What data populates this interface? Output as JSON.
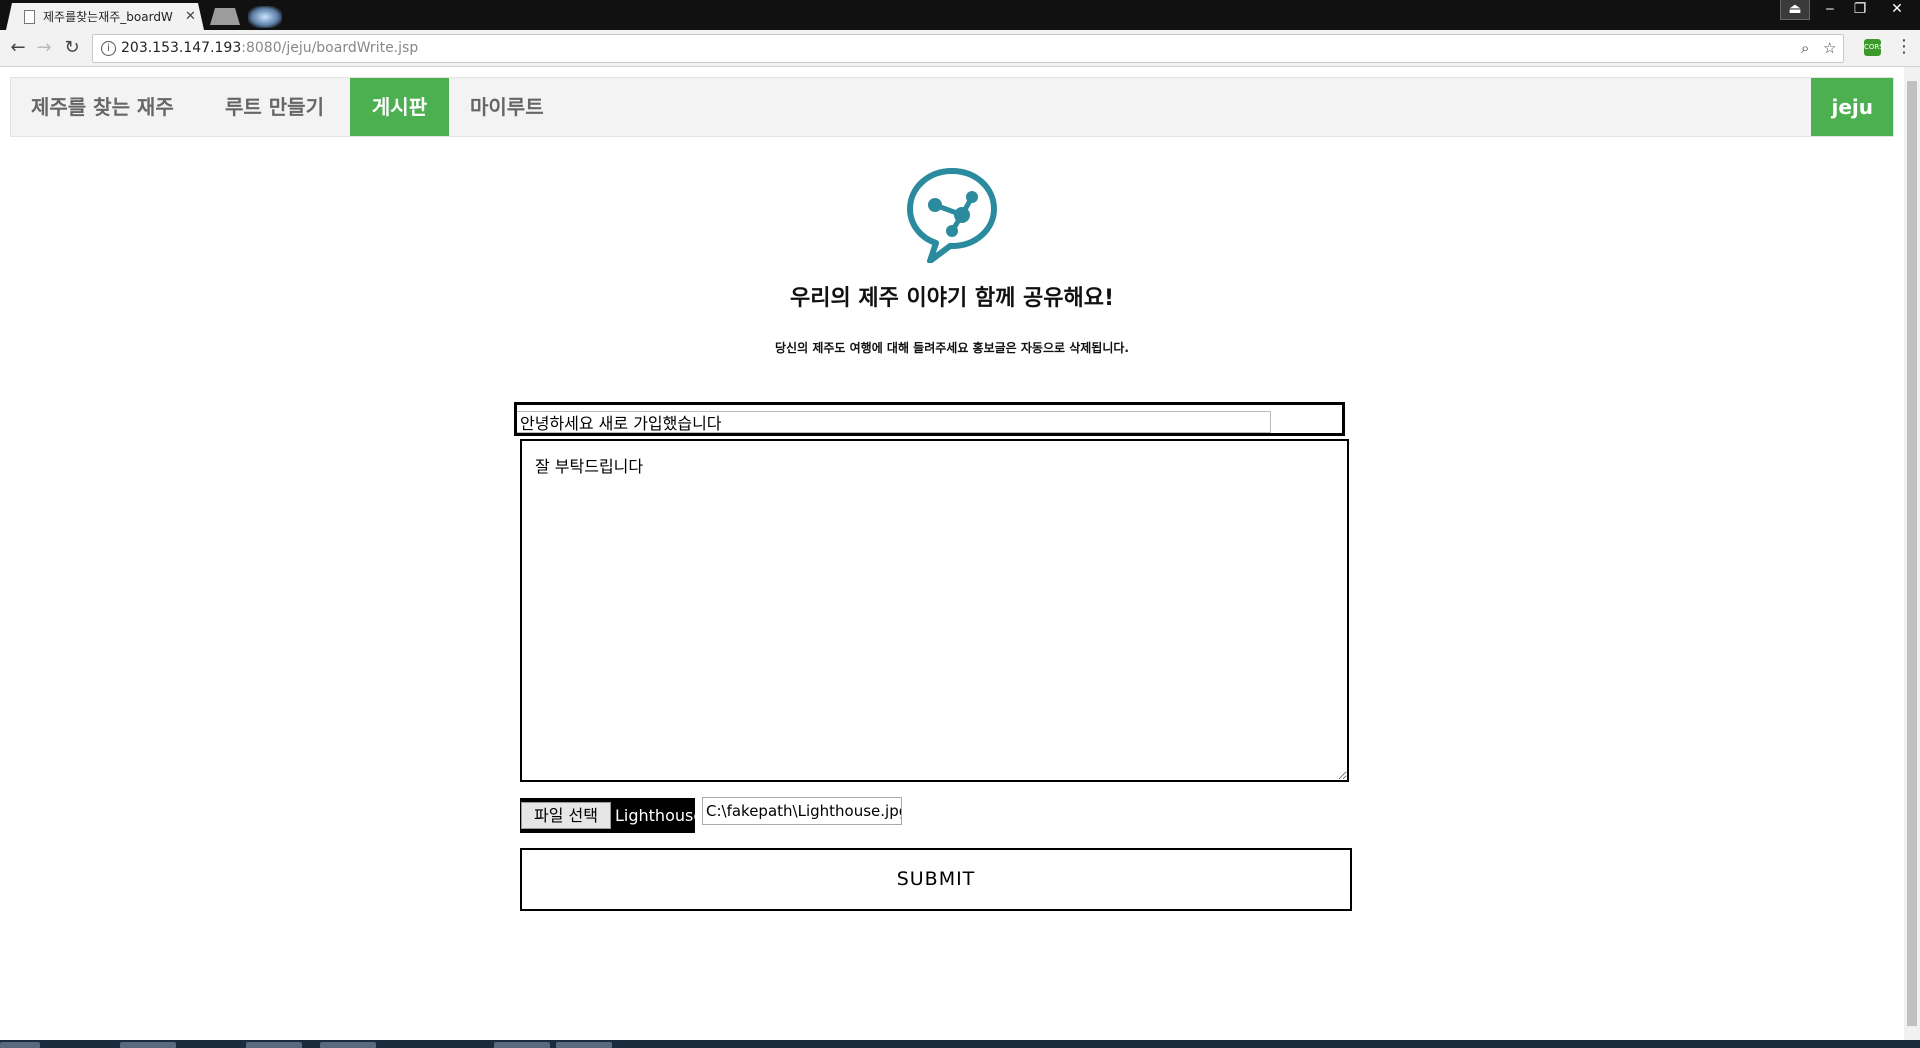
{
  "browser": {
    "tab_title": "제주를찾는재주_boardW",
    "url_host": "203.153.147.193",
    "url_path": ":8080/jeju/boardWrite.jsp",
    "ext_label": "CORS"
  },
  "nav": {
    "items": [
      "제주를 찾는 재주",
      "루트 만들기",
      "게시판",
      "마이루트"
    ],
    "active_index": 2,
    "user": "jeju"
  },
  "page": {
    "logo_icon": "share-chat-icon",
    "headline": "우리의 제주 이야기 함께 공유해요!",
    "subline": "당신의 제주도 여행에 대해 들려주세요 홍보글은 자동으로 삭제됩니다."
  },
  "form": {
    "title_value": "안녕하세요 새로 가입했습니다",
    "content_value": "잘 부탁드립니다",
    "file_button": "파일 선택",
    "file_name": "Lighthouse.jpg",
    "file_path": "C:\\fakepath\\Lighthouse.jpg",
    "submit_label": "SUBMIT"
  },
  "colors": {
    "accent": "#4caf50",
    "logo": "#2a8a9e"
  }
}
